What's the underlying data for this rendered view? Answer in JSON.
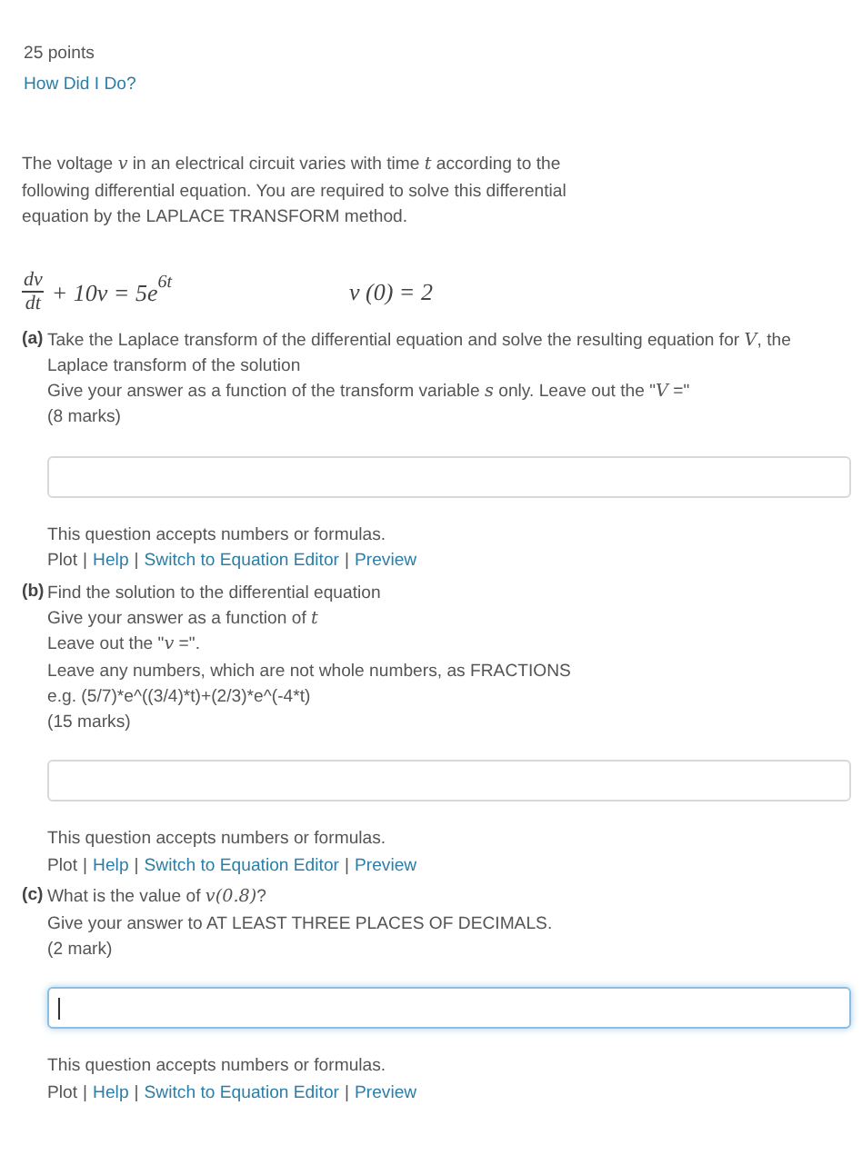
{
  "points": "25 points",
  "feedback_link": "How Did I Do?",
  "intro": "The voltage *v*  in an electrical circuit varies with time *t*   according to the following differential equation. You are required to solve this differential equation by the LAPLACE TRANSFORM method.",
  "equation": {
    "numerator": "dv",
    "denominator": "dt",
    "rest": "+ 10v = 5e",
    "exponent": "6t",
    "condition": "v (0) = 2"
  },
  "parts": [
    {
      "label": "(a)",
      "lines": [
        "Take the Laplace transform of the differential equation and solve the resulting equation for *V*, the Laplace transform of the solution",
        "Give your answer as a function of the transform variable *s* only. Leave out the \"*V* =\"",
        "(8 marks)"
      ],
      "answer": {
        "focused": false
      },
      "note": "This question accepts numbers or formulas.",
      "tools": [
        {
          "label": "Plot",
          "kind": "text"
        },
        {
          "label": "|",
          "kind": "separator"
        },
        {
          "label": "Help",
          "kind": "link"
        },
        {
          "label": "|",
          "kind": "separator"
        },
        {
          "label": "Switch to Equation Editor",
          "kind": "link"
        },
        {
          "label": "|",
          "kind": "separator"
        },
        {
          "label": "Preview",
          "kind": "link"
        }
      ]
    },
    {
      "label": "(b)",
      "lines": [
        "Find the solution to the differential equation",
        "Give your answer as a function of *t*",
        "Leave out the \"*v* =\".",
        "Leave any numbers, which are not whole numbers, as FRACTIONS",
        "e.g. (5/7)*e^((3/4)*t)+(2/3)*e^(-4*t)",
        "(15 marks)"
      ],
      "answer": {
        "focused": false
      },
      "note": "This question accepts numbers or formulas.",
      "tools": [
        {
          "label": "Plot",
          "kind": "text"
        },
        {
          "label": "|",
          "kind": "separator"
        },
        {
          "label": "Help",
          "kind": "link"
        },
        {
          "label": "|",
          "kind": "separator"
        },
        {
          "label": "Switch to Equation Editor",
          "kind": "link"
        },
        {
          "label": "|",
          "kind": "separator"
        },
        {
          "label": "Preview",
          "kind": "link"
        }
      ]
    },
    {
      "label": "(c)",
      "lines": [
        "What is the value of *v(0.8)*?",
        "Give your answer to AT LEAST THREE PLACES OF DECIMALS.",
        "(2 mark)"
      ],
      "answer": {
        "focused": true
      },
      "note": "This question accepts numbers or formulas.",
      "tools": [
        {
          "label": "Plot",
          "kind": "text"
        },
        {
          "label": "|",
          "kind": "separator"
        },
        {
          "label": "Help",
          "kind": "link"
        },
        {
          "label": "|",
          "kind": "separator"
        },
        {
          "label": "Switch to Equation Editor",
          "kind": "link"
        },
        {
          "label": "|",
          "kind": "separator"
        },
        {
          "label": "Preview",
          "kind": "link"
        }
      ]
    }
  ]
}
